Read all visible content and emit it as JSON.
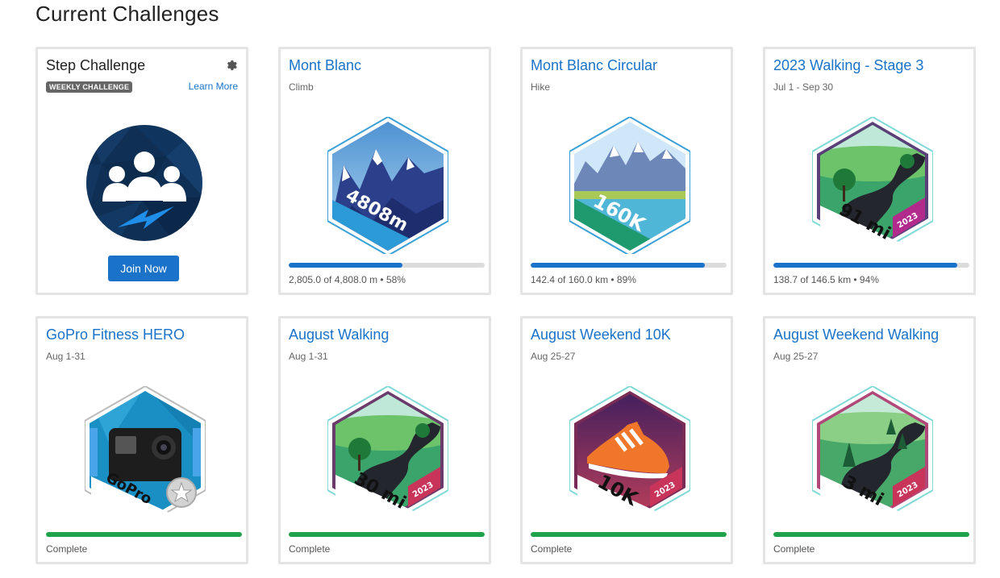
{
  "page": {
    "title": "Current Challenges"
  },
  "colors": {
    "accent": "#1a73c9",
    "complete": "#1fa34a",
    "track": "#dcdcdc"
  },
  "step_challenge": {
    "title": "Step Challenge",
    "tag": "WEEKLY CHALLENGE",
    "learn_more": "Learn More",
    "join_label": "Join Now",
    "gear_icon": "gear-icon",
    "image_icon": "group-lightning-icon"
  },
  "cards": [
    {
      "title": "Mont Blanc",
      "subtitle": "Climb",
      "badge_text": "4808m",
      "progress_percent": 58,
      "status": "2,805.0 of 4,808.0 m • 58%"
    },
    {
      "title": "Mont Blanc Circular",
      "subtitle": "Hike",
      "badge_text": "160K",
      "progress_percent": 89,
      "status": "142.4 of 160.0 km • 89%"
    },
    {
      "title": "2023 Walking - Stage 3",
      "subtitle": "Jul 1 - Sep 30",
      "badge_text": "91 mi",
      "badge_year": "2023",
      "progress_percent": 94,
      "status": "138.7 of 146.5 km • 94%"
    },
    {
      "title": "GoPro Fitness HERO",
      "subtitle": "Aug 1-31",
      "badge_text": "GoPro",
      "progress_percent": 100,
      "status": "Complete"
    },
    {
      "title": "August Walking",
      "subtitle": "Aug 1-31",
      "badge_text": "30 mi",
      "badge_year": "2023",
      "progress_percent": 100,
      "status": "Complete"
    },
    {
      "title": "August Weekend 10K",
      "subtitle": "Aug 25-27",
      "badge_text": "10K",
      "badge_year": "2023",
      "progress_percent": 100,
      "status": "Complete"
    },
    {
      "title": "August Weekend Walking",
      "subtitle": "Aug 25-27",
      "badge_text": "3 mi",
      "badge_year": "2023",
      "progress_percent": 100,
      "status": "Complete"
    }
  ]
}
